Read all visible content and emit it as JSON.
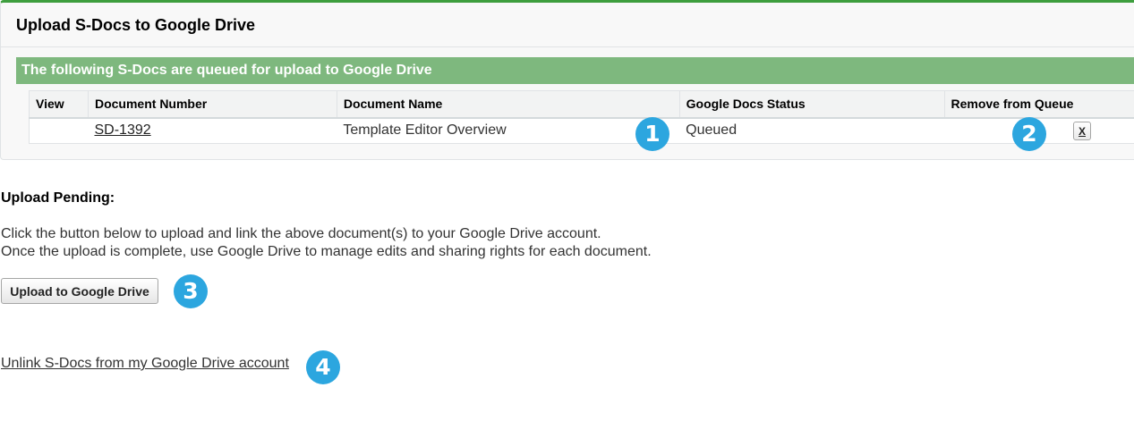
{
  "panel": {
    "title": "Upload S-Docs to Google Drive",
    "section_header": "The following S-Docs are queued for upload to Google Drive",
    "border_color": "#3e9e3e",
    "section_color": "#7eb87e"
  },
  "table": {
    "columns": [
      "View",
      "Document Number",
      "Document Name",
      "Google Docs Status",
      "Remove from Queue"
    ],
    "rows": [
      {
        "view": "",
        "document_number": "SD-1392",
        "document_name": "Template Editor Overview",
        "status": "Queued",
        "remove_label": "X"
      }
    ]
  },
  "badges": [
    "1",
    "2",
    "3",
    "4"
  ],
  "badge_color": "#2ca6df",
  "upload": {
    "title": "Upload Pending:",
    "line1": "Click the button below to upload and link the above document(s) to your Google Drive account.",
    "line2": "Once the upload is complete, use Google Drive to manage edits and sharing rights for each document.",
    "button_label": "Upload to Google Drive"
  },
  "unlink_label": "Unlink S-Docs from my Google Drive account"
}
